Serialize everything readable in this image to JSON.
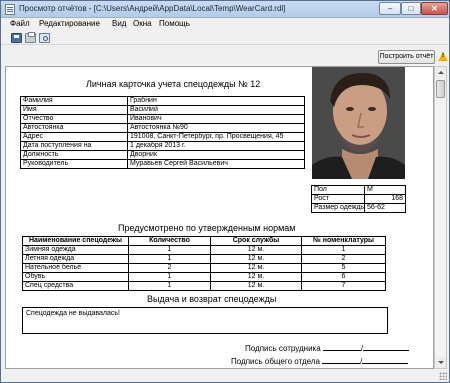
{
  "window": {
    "title": "Просмотр отчётов - [C:\\Users\\Андрей\\AppData\\Local\\Temp\\WearCard.rdl]",
    "minimize": "–",
    "maximize": "□",
    "close": "✕"
  },
  "menu": {
    "items": [
      "Файл",
      "Редактирование",
      "Вид",
      "Окна",
      "Помощь"
    ]
  },
  "actions": {
    "build_report": "Построить отчёт"
  },
  "report": {
    "title": "Личная карточка учета спецодежды № 12",
    "info_rows": [
      {
        "label": "Фамилия",
        "value": "Грабнин"
      },
      {
        "label": "Имя",
        "value": "Василий"
      },
      {
        "label": "Отчество",
        "value": "Иванович"
      },
      {
        "label": "Автостоянка",
        "value": "Автостоянка №90"
      },
      {
        "label": "Адрес",
        "value": "191008, Санкт-Петербург, пр. Просвещения, 45"
      },
      {
        "label": "Дата поступления на",
        "value": "1 декабря 2013 г."
      },
      {
        "label": "Должность",
        "value": "Дворник"
      },
      {
        "label": "Руководитель",
        "value": "Муравьев Сергей Васильевич"
      }
    ],
    "phys_rows": [
      {
        "label": "Пол",
        "value": "М"
      },
      {
        "label": "Рост",
        "value": "168"
      },
      {
        "label": "Размер одежды",
        "value": "56-62"
      }
    ],
    "norms_title": "Предусмотрено по утвержденным нормам",
    "norms_headers": [
      "Наименование спецодежы",
      "Количество",
      "Срок службы",
      "№ номенклатуры"
    ],
    "norms_rows": [
      [
        "Зимняя одежда",
        "1",
        "12 м.",
        "1"
      ],
      [
        "Летняя одежда",
        "1",
        "12 м.",
        "2"
      ],
      [
        "Нательное белье",
        "2",
        "12 м.",
        "5"
      ],
      [
        "Обувь",
        "1",
        "12 м.",
        "6"
      ],
      [
        "Спец средства",
        "1",
        "12 м.",
        "7"
      ]
    ],
    "issue_title": "Выдача и возврат спецодежды",
    "issue_text": "Спецодежда не выдавалась!",
    "sign_employee": "Подпись сотрудника",
    "sign_department": "Подпись общего отдела",
    "sign_separator": "/"
  }
}
